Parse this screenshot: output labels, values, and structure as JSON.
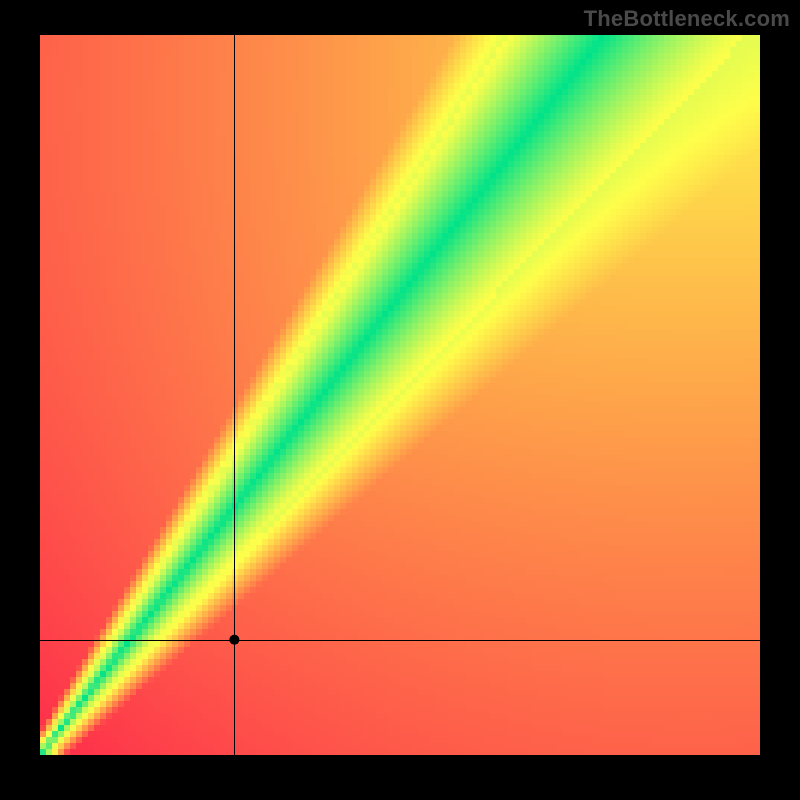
{
  "watermark": "TheBottleneck.com",
  "chart_data": {
    "type": "heatmap",
    "title": "",
    "xlabel": "",
    "ylabel": "",
    "x_range": [
      0,
      100
    ],
    "y_range": [
      0,
      100
    ],
    "resolution": 120,
    "crosshair": {
      "x": 27,
      "y": 16
    },
    "diagonal_band": {
      "upper_slope": 1.55,
      "lower_slope": 1.05,
      "upper_intercept": 0,
      "lower_intercept": 0
    },
    "colors": {
      "red": "#ff2b4a",
      "yellow": "#feff4a",
      "green": "#00e38a",
      "crosshair": "#000000"
    },
    "grid": false,
    "legend": false
  }
}
